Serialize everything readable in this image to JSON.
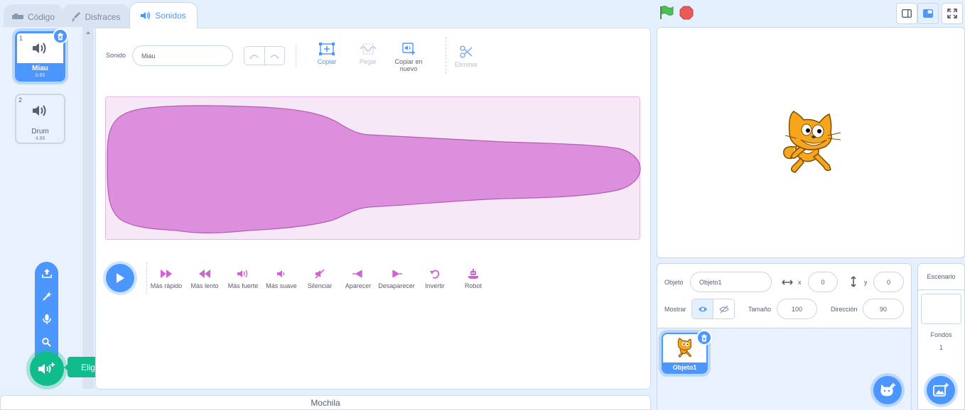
{
  "tabs": [
    {
      "label": "Código",
      "icon": "code-icon"
    },
    {
      "label": "Disfraces",
      "icon": "brush-icon"
    },
    {
      "label": "Sonidos",
      "icon": "speaker-icon",
      "active": true
    }
  ],
  "sounds": [
    {
      "num": "1",
      "name": "Miau",
      "duration": "0.85",
      "selected": true
    },
    {
      "num": "2",
      "name": "Drum",
      "duration": "4.88",
      "selected": false
    }
  ],
  "add_menu": {
    "items": [
      "upload-icon",
      "surprise-icon",
      "microphone-icon",
      "search-icon"
    ],
    "tooltip": "Elige un sonido"
  },
  "editor": {
    "name_label": "Sonido",
    "name_value": "Miau",
    "tools": {
      "copy": "Copiar",
      "paste": "Pegar",
      "copy_new": "Copiar en nuevo",
      "delete": "Eliminar"
    },
    "effects": [
      "Más rápido",
      "Más lento",
      "Más fuerte",
      "Más suave",
      "Silenciar",
      "Aparecer",
      "Desaparecer",
      "Invertir",
      "Robot"
    ],
    "wave_color": "#cf63cf"
  },
  "backpack": "Mochila",
  "sprite_info": {
    "sprite_label": "Objeto",
    "sprite_name": "Objeto1",
    "x_label": "x",
    "x_value": "0",
    "y_label": "y",
    "y_value": "0",
    "show_label": "Mostrar",
    "size_label": "Tamaño",
    "size_value": "100",
    "direction_label": "Dirección",
    "direction_value": "90"
  },
  "sprites": [
    {
      "name": "Objeto1"
    }
  ],
  "backdrop": {
    "title": "Escenario",
    "fondos_label": "Fondos",
    "fondos_count": "1"
  },
  "colors": {
    "accent": "#4c97ff",
    "green": "#0fbd8c",
    "sound": "#cf63cf",
    "flag": "#4cbf56",
    "stop": "#ec5959"
  }
}
